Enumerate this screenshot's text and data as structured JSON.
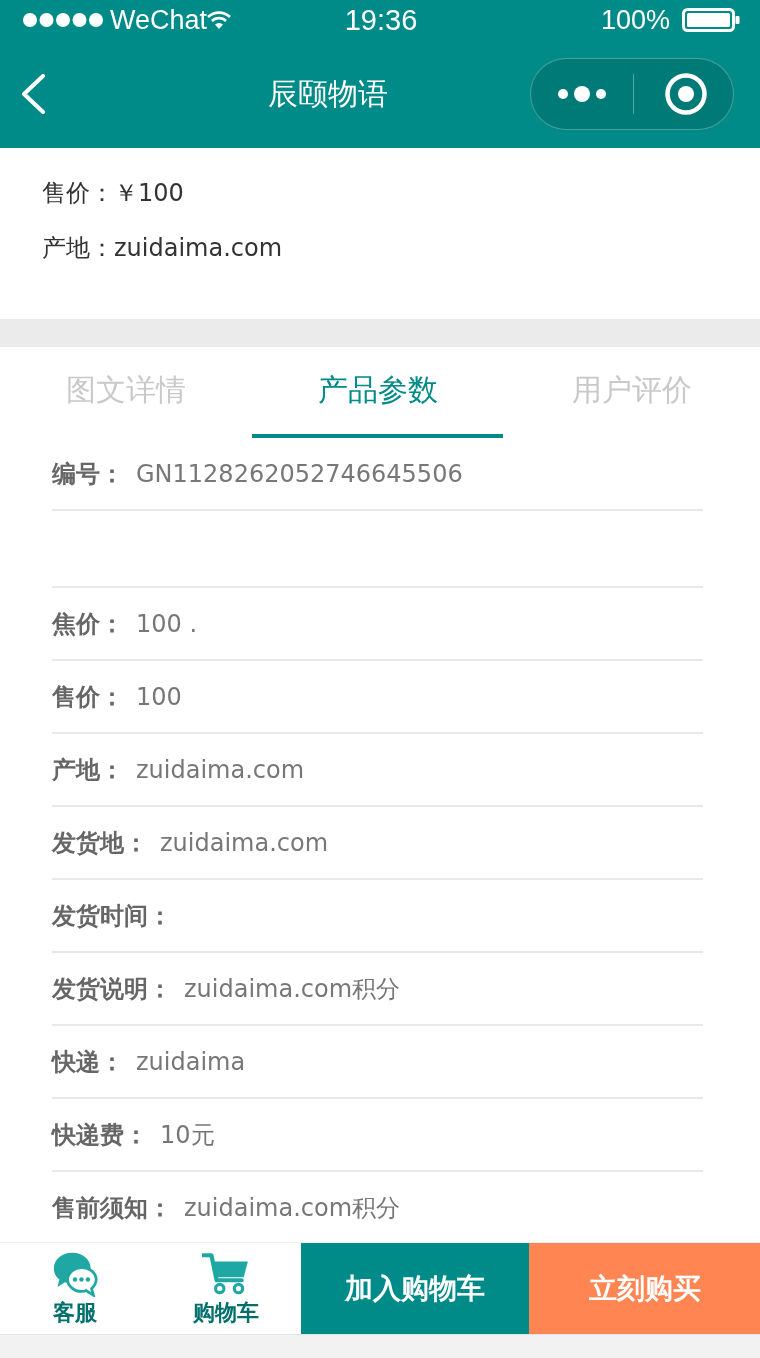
{
  "status_bar": {
    "carrier": "WeChat",
    "time": "19:36",
    "battery": "100%"
  },
  "nav_bar": {
    "title": "辰颐物语"
  },
  "summary": [
    {
      "text": "售价：￥100"
    },
    {
      "text": "产地：zuidaima.com"
    }
  ],
  "tabs": [
    {
      "label": "图文详情",
      "selected": false
    },
    {
      "label": "产品参数",
      "selected": true
    },
    {
      "label": "用户评价",
      "selected": false
    }
  ],
  "params": [
    {
      "kind": "field",
      "label": "编号：",
      "value": "GN1128262052746645506"
    },
    {
      "kind": "blank"
    },
    {
      "kind": "field",
      "label": "焦价：",
      "value": "100 ."
    },
    {
      "kind": "field",
      "label": "售价：",
      "value": "100"
    },
    {
      "kind": "field",
      "label": "产地：",
      "value": "zuidaima.com"
    },
    {
      "kind": "field",
      "label": "发货地：",
      "value": "zuidaima.com"
    },
    {
      "kind": "field",
      "label": "发货时间："
    },
    {
      "kind": "field",
      "label": "发货说明：",
      "value": "zuidaima.com积分"
    },
    {
      "kind": "field",
      "label": "快递：",
      "value": "zuidaima"
    },
    {
      "kind": "field",
      "label": "快递费：",
      "value": "10元"
    },
    {
      "kind": "field",
      "label": "售前须知：",
      "value": "zuidaima.com积分"
    }
  ],
  "bottom_bar": {
    "actions": [
      {
        "kind": "chat",
        "label": "客服"
      },
      {
        "kind": "cart",
        "label": "购物车"
      }
    ],
    "buttons": [
      {
        "kind": "primary",
        "label": "加入购物车"
      },
      {
        "kind": "accent",
        "label": "立刻购买"
      }
    ]
  }
}
